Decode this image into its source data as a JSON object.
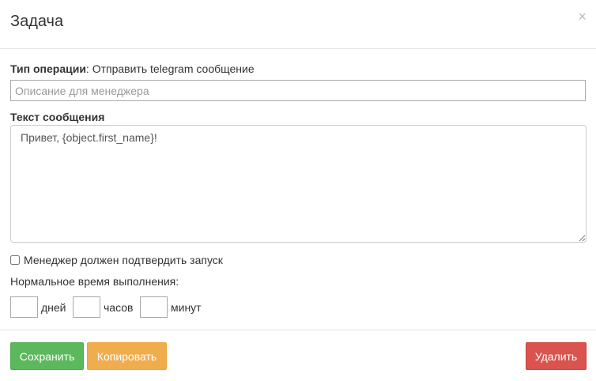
{
  "modal": {
    "title": "Задача",
    "close_icon": "close-icon",
    "close_glyph": "×"
  },
  "operation": {
    "label": "Тип операции",
    "separator": ":",
    "value": "Отправить telegram сообщение"
  },
  "description": {
    "value": "",
    "placeholder": "Описание для менеджера"
  },
  "message": {
    "label": "Текст сообщения",
    "value": "Привет, {object.first_name}!"
  },
  "confirm": {
    "label": "Менеджер должен подтвердить запуск",
    "checked": false
  },
  "normal_time": {
    "label": "Нормальное время выполнения:",
    "days_label": "дней",
    "hours_label": "часов",
    "minutes_label": "минут",
    "days_value": "",
    "hours_value": "",
    "minutes_value": ""
  },
  "footer": {
    "save_label": "Сохранить",
    "copy_label": "Копировать",
    "delete_label": "Удалить"
  },
  "colors": {
    "save": "#5cb85c",
    "copy": "#f0ad4e",
    "delete": "#d9534f"
  }
}
